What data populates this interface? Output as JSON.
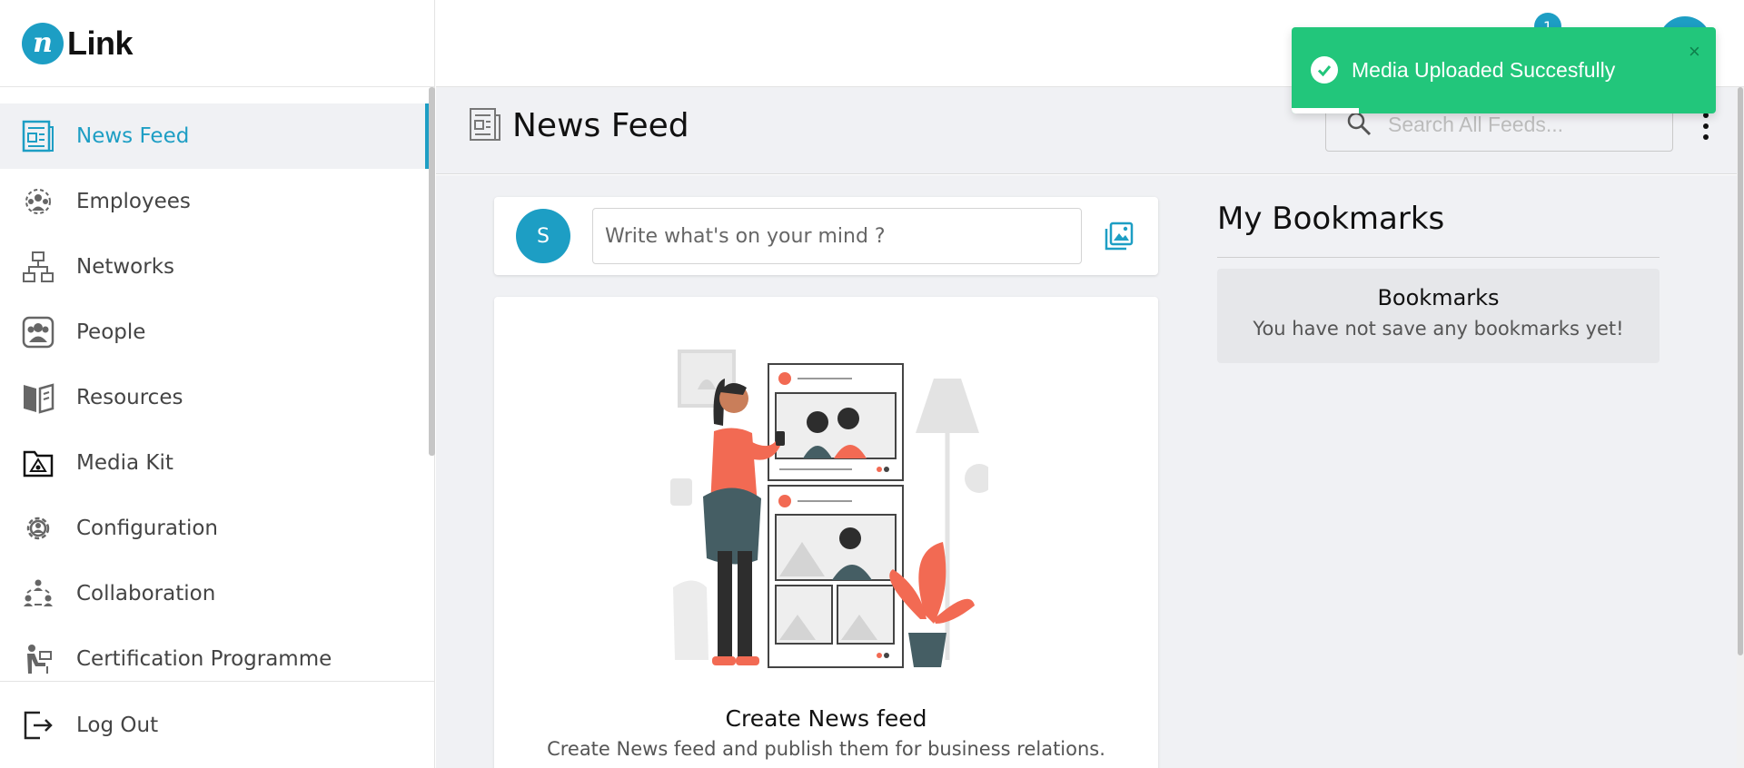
{
  "brand": {
    "logo_letter": "n",
    "name": "Link"
  },
  "sidebar": {
    "items": [
      {
        "label": "News Feed",
        "icon": "newspaper-icon",
        "active": true
      },
      {
        "label": "Employees",
        "icon": "employees-icon",
        "active": false
      },
      {
        "label": "Networks",
        "icon": "network-icon",
        "active": false
      },
      {
        "label": "People",
        "icon": "people-icon",
        "active": false
      },
      {
        "label": "Resources",
        "icon": "book-icon",
        "active": false
      },
      {
        "label": "Media Kit",
        "icon": "media-kit-icon",
        "active": false
      },
      {
        "label": "Configuration",
        "icon": "gear-icon",
        "active": false
      },
      {
        "label": "Collaboration",
        "icon": "collaboration-icon",
        "active": false
      },
      {
        "label": "Certification Programme",
        "icon": "certification-icon",
        "active": false
      }
    ],
    "logout_label": "Log Out"
  },
  "topbar": {
    "notification_count": "1"
  },
  "page": {
    "title": "News Feed",
    "search_placeholder": "Search All Feeds..."
  },
  "composer": {
    "avatar_initial": "S",
    "placeholder": "Write what's on your mind ?"
  },
  "feed_empty": {
    "title": "Create News feed",
    "subtitle": "Create News feed and publish them for business relations."
  },
  "bookmarks": {
    "heading": "My Bookmarks",
    "box_title": "Bookmarks",
    "box_text": "You have not save any bookmarks yet!"
  },
  "toast": {
    "message": "Media Uploaded Succesfully",
    "close": "×"
  },
  "colors": {
    "accent": "#1d9ec4",
    "toast_green": "#22c67b",
    "illustration_coral": "#f26a53"
  }
}
